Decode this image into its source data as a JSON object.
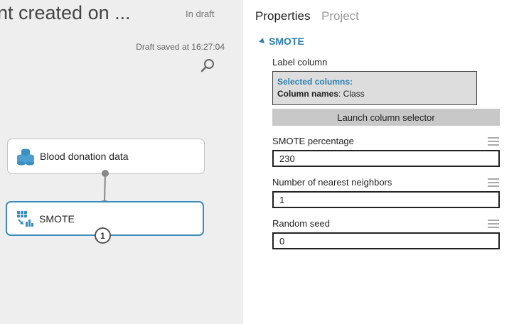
{
  "canvas": {
    "experiment_title": "nt created on ...",
    "draft_status": "In draft",
    "draft_saved": "Draft saved at 16:27:04",
    "zoom_icon": "magnifier-icon",
    "modules": [
      {
        "label": "Blood donation data",
        "icon": "dataset-icon"
      },
      {
        "label": "SMOTE",
        "icon": "smote-module-icon",
        "output_port": "1"
      }
    ],
    "accent_color": "#3c8dbf"
  },
  "properties": {
    "tabs": [
      "Properties",
      "Project"
    ],
    "section_title": "SMOTE",
    "label_column": {
      "label": "Label column",
      "selected_columns_title": "Selected columns:",
      "column_names_label": "Column names",
      "column_names_value": ": Class"
    },
    "launch_button": "Launch column selector",
    "params": [
      {
        "label": "SMOTE percentage",
        "value": "230"
      },
      {
        "label": "Number of nearest neighbors",
        "value": "1"
      },
      {
        "label": "Random seed",
        "value": "0"
      }
    ],
    "accent_color": "#2c7fb0"
  }
}
